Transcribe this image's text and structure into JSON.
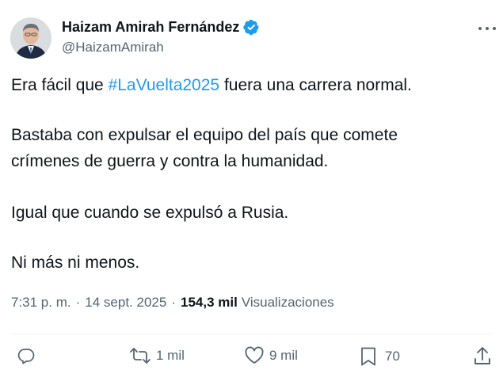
{
  "author": {
    "name": "Haizam Amirah Fernández",
    "handle": "@HaizamAmirah"
  },
  "tweet": {
    "line1_before": "Era fácil que ",
    "line1_hashtag": "#LaVuelta2025",
    "line1_after": " fuera una carrera normal.",
    "line2": "Bastaba con expulsar el equipo del país que comete",
    "line3": "crímenes de guerra y contra la humanidad.",
    "line4": "Igual que cuando se expulsó a Rusia.",
    "line5": "Ni más ni menos."
  },
  "meta": {
    "time": "7:31 p. m.",
    "separator": "·",
    "date": "14 sept. 2025",
    "views_count": "154,3 mil",
    "views_label": "Visualizaciones"
  },
  "actions": {
    "reply_icon": "reply-icon",
    "repost_icon": "repost-icon",
    "repost_count": "1 mil",
    "like_icon": "heart-icon",
    "like_count": "9 mil",
    "bookmark_icon": "bookmark-icon",
    "bookmark_count": "70",
    "share_icon": "share-icon"
  },
  "colors": {
    "accent": "#1d9bf0",
    "text": "#0f1419",
    "secondary": "#536471"
  }
}
